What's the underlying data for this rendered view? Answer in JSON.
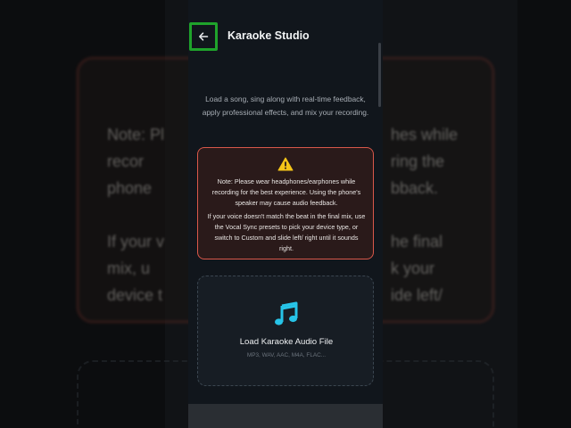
{
  "header": {
    "back_icon": "arrow-left-icon",
    "title": "Karaoke Studio"
  },
  "intro": {
    "text": "Load a song, sing along with real-time feedback, apply professional effects, and mix your recording."
  },
  "warning": {
    "icon": "warning-triangle-icon",
    "accent_color": "#d9584a",
    "icon_color": "#f5c518",
    "paragraph1": "Note: Please wear headphones/earphones while recording for the best experience. Using the phone's speaker may cause audio feedback.",
    "paragraph2": "If your voice doesn't match the beat in the final mix, use the Vocal Sync presets to pick your device type, or switch to Custom and slide left/ right until it sounds right."
  },
  "upload": {
    "icon": "music-note-icon",
    "icon_color": "#27c4e8",
    "title": "Load Karaoke Audio File",
    "formats": "MP3, WAV, AAC, M4A, FLAC..."
  },
  "background": {
    "left_text": "Note: Pl\nrecor\nphone\n\nIf your v\nmix, u\ndevice t",
    "right_text": "hes while\nring the\nbback.\n\nhe final\nk your\nide left/"
  }
}
